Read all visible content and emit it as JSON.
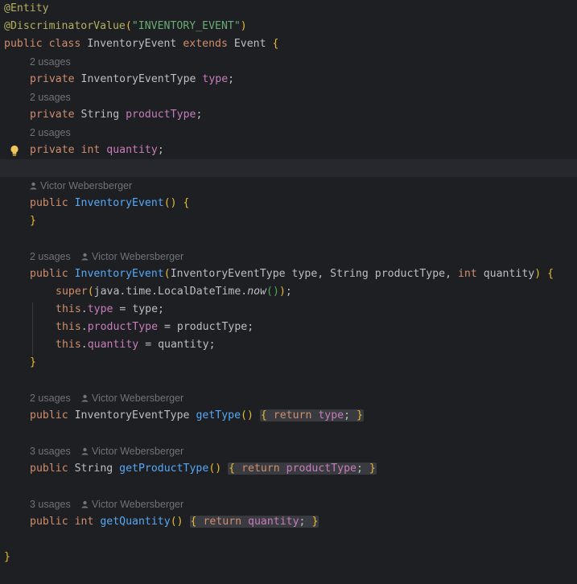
{
  "editor": {
    "usages": {
      "two": "2 usages",
      "three": "3 usages"
    },
    "author": "Victor Webersberger",
    "code": {
      "l1": "@Entity",
      "l2_ann": "@DiscriminatorValue",
      "l2_str": "\"INVENTORY_EVENT\"",
      "l3_kw1": "public class ",
      "l3_name": "InventoryEvent ",
      "l3_kw2": "extends ",
      "l3_parent": "Event ",
      "private": "private ",
      "int": "int ",
      "type_InventoryEventType": "InventoryEventType ",
      "type_String": "String ",
      "f_type": "type",
      "f_productType": "productType",
      "f_quantity": "quantity",
      "semi": ";",
      "public": "public ",
      "ctor": "InventoryEvent",
      "ctor_params_1": "InventoryEventType type, String productType, ",
      "ctor_params_int": "int ",
      "ctor_params_2": "quantity",
      "super": "super",
      "super_arg": "java.time.LocalDateTime.",
      "now": "now",
      "this": "this",
      "eq_type": " = type;",
      "eq_productType": " = productType;",
      "eq_quantity": " = quantity;",
      "getType": "getType",
      "getProductType": "getProductType",
      "getQuantity": "getQuantity",
      "return": "return "
    }
  }
}
